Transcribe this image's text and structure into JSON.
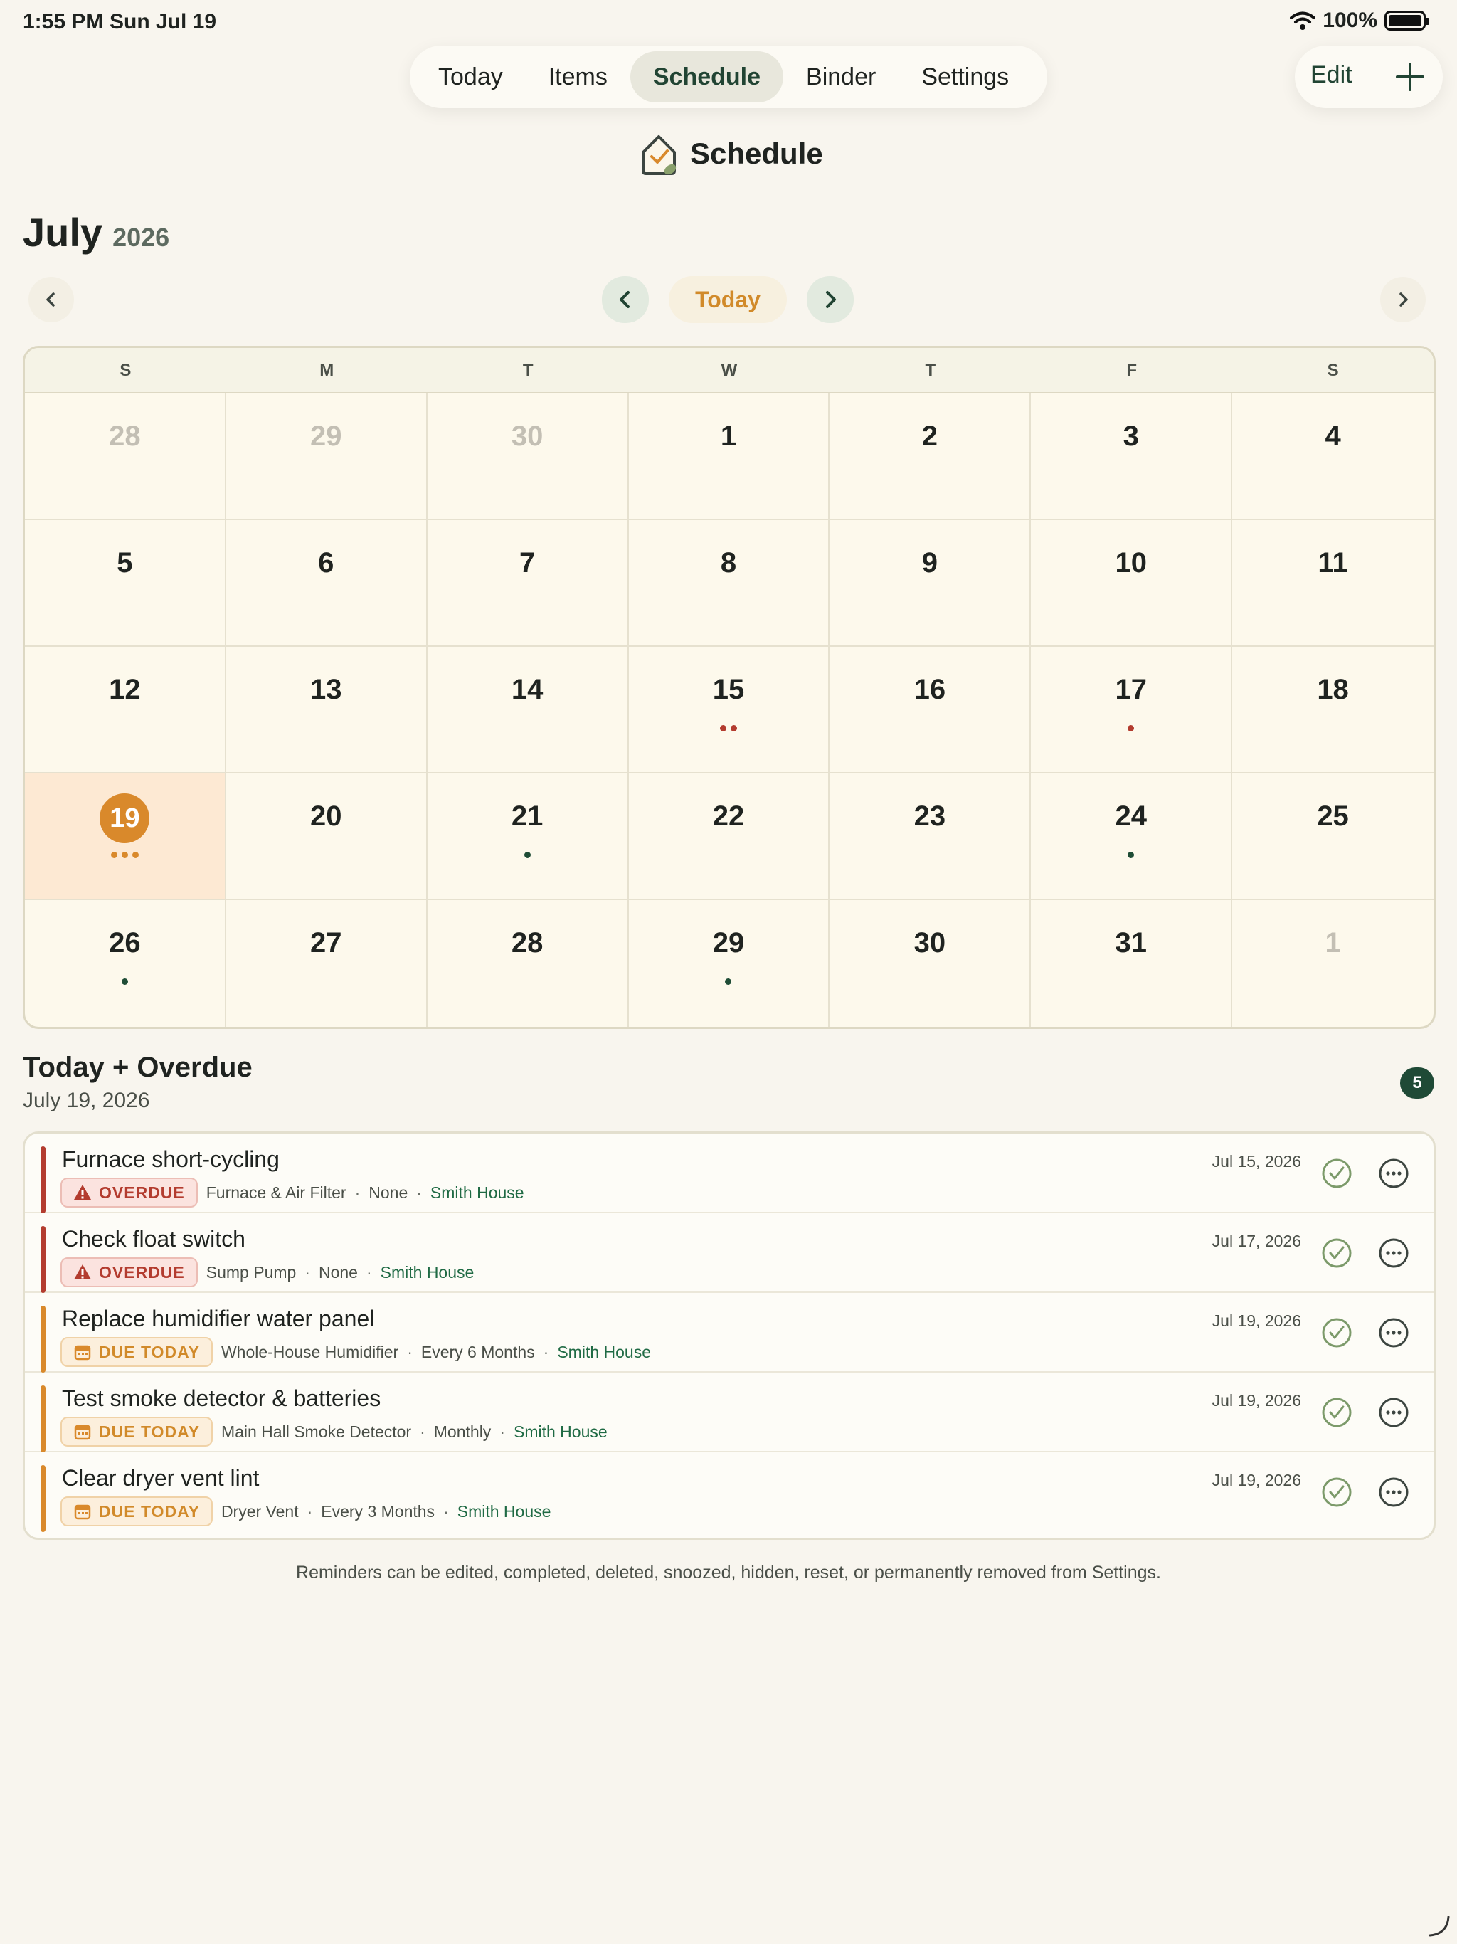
{
  "status": {
    "time": "1:55 PM",
    "date": "Sun Jul 19",
    "battery": "100%"
  },
  "tabs": [
    {
      "label": "Today"
    },
    {
      "label": "Items"
    },
    {
      "label": "Schedule",
      "active": true
    },
    {
      "label": "Binder"
    },
    {
      "label": "Settings"
    }
  ],
  "toolbar": {
    "edit_label": "Edit"
  },
  "app": {
    "title": "Schedule"
  },
  "calendar": {
    "month": "July",
    "year": "2026",
    "today_label": "Today",
    "weekdays": [
      "S",
      "M",
      "T",
      "W",
      "T",
      "F",
      "S"
    ],
    "days": [
      {
        "n": "28",
        "muted": true
      },
      {
        "n": "29",
        "muted": true
      },
      {
        "n": "30",
        "muted": true
      },
      {
        "n": "1"
      },
      {
        "n": "2"
      },
      {
        "n": "3"
      },
      {
        "n": "4"
      },
      {
        "n": "5"
      },
      {
        "n": "6"
      },
      {
        "n": "7"
      },
      {
        "n": "8"
      },
      {
        "n": "9"
      },
      {
        "n": "10"
      },
      {
        "n": "11"
      },
      {
        "n": "12"
      },
      {
        "n": "13"
      },
      {
        "n": "14"
      },
      {
        "n": "15",
        "dots": [
          "red",
          "red"
        ]
      },
      {
        "n": "16"
      },
      {
        "n": "17",
        "dots": [
          "red"
        ]
      },
      {
        "n": "18"
      },
      {
        "n": "19",
        "selected": true,
        "dots": [
          "orange",
          "orange",
          "orange"
        ]
      },
      {
        "n": "20"
      },
      {
        "n": "21",
        "dots": [
          "green"
        ]
      },
      {
        "n": "22"
      },
      {
        "n": "23"
      },
      {
        "n": "24",
        "dots": [
          "green"
        ]
      },
      {
        "n": "25"
      },
      {
        "n": "26",
        "dots": [
          "green"
        ]
      },
      {
        "n": "27"
      },
      {
        "n": "28"
      },
      {
        "n": "29",
        "dots": [
          "green"
        ]
      },
      {
        "n": "30"
      },
      {
        "n": "31"
      },
      {
        "n": "1",
        "muted": true
      }
    ],
    "dot_colors": {
      "red": "#b33c2f",
      "green": "#1f4d36",
      "orange": "#d9892b"
    }
  },
  "section": {
    "title": "Today + Overdue",
    "date": "July 19, 2026",
    "count": "5"
  },
  "reminders": [
    {
      "title": "Furnace short-cycling",
      "status": "OVERDUE",
      "kind": "overdue",
      "item": "Furnace & Air Filter",
      "freq": "None",
      "house": "Smith House",
      "date": "Jul 15, 2026"
    },
    {
      "title": "Check float switch",
      "status": "OVERDUE",
      "kind": "overdue",
      "item": "Sump Pump",
      "freq": "None",
      "house": "Smith House",
      "date": "Jul 17, 2026"
    },
    {
      "title": "Replace humidifier water panel",
      "status": "DUE TODAY",
      "kind": "due",
      "item": "Whole-House Humidifier",
      "freq": "Every 6 Months",
      "house": "Smith House",
      "date": "Jul 19, 2026"
    },
    {
      "title": "Test smoke detector & batteries",
      "status": "DUE TODAY",
      "kind": "due",
      "item": "Main Hall Smoke Detector",
      "freq": "Monthly",
      "house": "Smith House",
      "date": "Jul 19, 2026"
    },
    {
      "title": "Clear dryer vent lint",
      "status": "DUE TODAY",
      "kind": "due",
      "item": "Dryer Vent",
      "freq": "Every 3 Months",
      "house": "Smith House",
      "date": "Jul 19, 2026"
    }
  ],
  "footer": {
    "note": "Reminders can be edited, completed, deleted, snoozed, hidden, reset, or permanently removed from Settings."
  },
  "colors": {
    "accent_green": "#214433",
    "accent_orange": "#d9892b",
    "overdue_red": "#b33c2f",
    "background": "#f8f5ee"
  },
  "icons": [
    "wifi-icon",
    "battery-icon",
    "plus-icon",
    "app-logo-icon",
    "chevron-left-icon",
    "chevron-right-icon",
    "warning-icon",
    "calendar-icon",
    "check-circle-icon",
    "more-icon"
  ]
}
